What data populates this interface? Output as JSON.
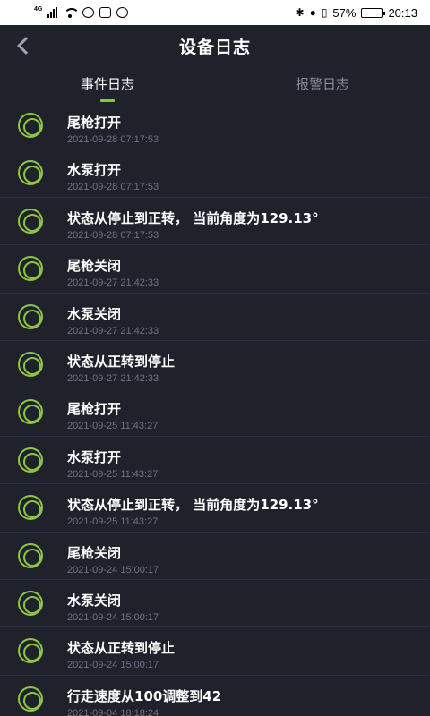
{
  "status_bar": {
    "network": "4G",
    "battery": "57%",
    "battery_level": 0.57,
    "time": "20:13"
  },
  "header": {
    "title": "设备日志",
    "back_icon": "chevron-left-icon"
  },
  "tabs": [
    {
      "label": "事件日志",
      "active": true
    },
    {
      "label": "报警日志",
      "active": false
    }
  ],
  "colors": {
    "background": "#1f212b",
    "accent": "#8ec641",
    "muted": "#6f7384"
  },
  "events": [
    {
      "title": "尾枪打开",
      "time": "2021-09-28 07:17:53"
    },
    {
      "title": "水泵打开",
      "time": "2021-09-28 07:17:53"
    },
    {
      "title": "状态从停止到正转， 当前角度为129.13°",
      "time": "2021-09-28 07:17:53"
    },
    {
      "title": "尾枪关闭",
      "time": "2021-09-27 21:42:33"
    },
    {
      "title": "水泵关闭",
      "time": "2021-09-27 21:42:33"
    },
    {
      "title": "状态从正转到停止",
      "time": "2021-09-27 21:42:33"
    },
    {
      "title": "尾枪打开",
      "time": "2021-09-25 11:43:27"
    },
    {
      "title": "水泵打开",
      "time": "2021-09-25 11:43:27"
    },
    {
      "title": "状态从停止到正转， 当前角度为129.13°",
      "time": "2021-09-25 11:43:27"
    },
    {
      "title": "尾枪关闭",
      "time": "2021-09-24 15:00:17"
    },
    {
      "title": "水泵关闭",
      "time": "2021-09-24 15:00:17"
    },
    {
      "title": "状态从正转到停止",
      "time": "2021-09-24 15:00:17"
    },
    {
      "title": "行走速度从100调整到42",
      "time": "2021-09-04 18:18:24"
    }
  ]
}
